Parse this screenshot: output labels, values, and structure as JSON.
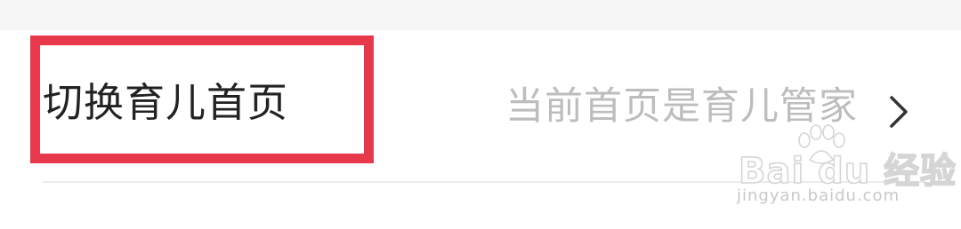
{
  "setting_row": {
    "title": "切换育儿首页",
    "current_value": "当前首页是育儿管家",
    "chevron_icon": "chevron-right-icon"
  },
  "annotation": {
    "highlight_color": "#e8384b"
  },
  "watermark": {
    "logo_text": "Bai du 经验",
    "url": "jingyan.baidu.com"
  }
}
